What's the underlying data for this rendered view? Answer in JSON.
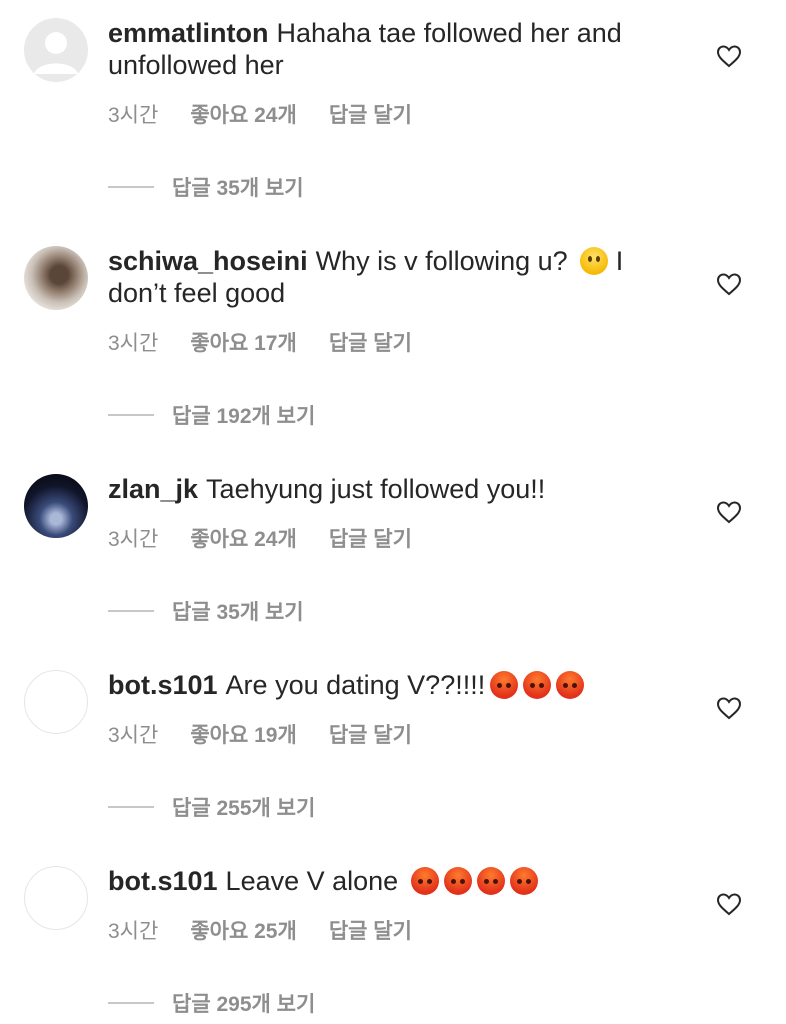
{
  "comments": [
    {
      "username": "emmatlinton",
      "text": "Hahaha tae followed her and unfollowed her",
      "time": "3시간",
      "likes": "좋아요 24개",
      "reply": "답글 달기",
      "view_replies": "답글 35개 보기",
      "avatar": "default-avatar",
      "emojis": []
    },
    {
      "username": "schiwa_hoseini",
      "text": "Why is v following u?",
      "text_after": "I don’t feel good",
      "time": "3시간",
      "likes": "좋아요 17개",
      "reply": "답글 달기",
      "view_replies": "답글 192개 보기",
      "avatar": "photo-avatar",
      "emojis": [
        "slightly-smiling-face"
      ]
    },
    {
      "username": "zlan_jk",
      "text": "Taehyung just followed you!!",
      "time": "3시간",
      "likes": "좋아요 24개",
      "reply": "답글 달기",
      "view_replies": "답글 35개 보기",
      "avatar": "photo-avatar",
      "emojis": []
    },
    {
      "username": "bot.s101",
      "text": "Are you dating V??!!!!",
      "time": "3시간",
      "likes": "좋아요 19개",
      "reply": "답글 달기",
      "view_replies": "답글 255개 보기",
      "avatar": "blank-avatar",
      "emojis": [
        "angry-face",
        "angry-face",
        "angry-face"
      ]
    },
    {
      "username": "bot.s101",
      "text": "Leave V alone",
      "time": "3시간",
      "likes": "좋아요 25개",
      "reply": "답글 달기",
      "view_replies": "답글 295개 보기",
      "avatar": "blank-avatar",
      "emojis": [
        "angry-face",
        "angry-face",
        "angry-face",
        "angry-face"
      ]
    }
  ],
  "colors": {
    "text": "#262626",
    "secondary": "#8e8e8e",
    "divider": "#c7c7c7"
  },
  "icons": {
    "like": "heart-outline-icon"
  }
}
